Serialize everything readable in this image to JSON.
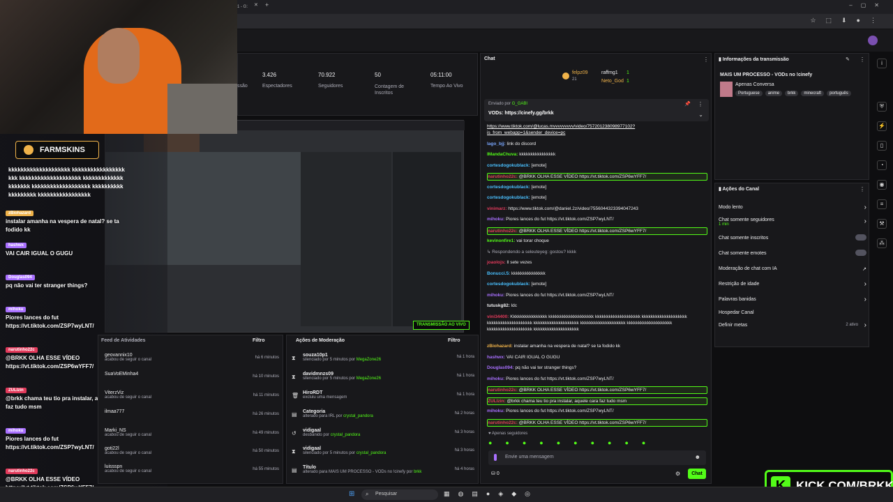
{
  "browser": {
    "tab_title": "1 - G:",
    "tab_plus": "+"
  },
  "stats": [
    {
      "value": "3.426",
      "label": "Espectadores"
    },
    {
      "value": "70.922",
      "label": "Seguidores"
    },
    {
      "value": "50",
      "label": "Contagem de Inscritos"
    },
    {
      "value": "05:11:00",
      "label": "Tempo Ao Vivo"
    }
  ],
  "stat_cut": "ssão",
  "overlay": {
    "sponsor": "FARMSKINS",
    "spam": "kkkkkkkkkkkkkkkkkkkk kkkkkkkkkkkkkkkkkkkk kkkkkkkkkkkkkkkkkkkk kkkkkkkkkkkkkkkkkkkk kkkkkkkkkkkkkkkkkkk kkkkkkkkkkkkkkkkkkk kkkkkkkkkkkkkkkkk",
    "messages": [
      {
        "user": "zBiohazard",
        "color": "#f0b34a",
        "text": "instalar amanha na vespera de natal? se ta fodido kk"
      },
      {
        "user": "hashwx",
        "color": "#a970ff",
        "text": "VAI CAIR IGUAL O GUGU"
      },
      {
        "user": "Douglas094",
        "color": "#a970ff",
        "text": "pq não vai ter stranger things?"
      },
      {
        "user": "mihoku",
        "color": "#a970ff",
        "text": "Piores lances do fut https://vt.tiktok.com/ZSP7wyLNT/"
      },
      {
        "user": "narutinho22c",
        "color": "#e23a5b",
        "text": "@BRKK OLHA ESSE VÍDEO https://vt.tiktok.com/ZSP6wYFF7/"
      },
      {
        "user": "ZULIzin",
        "color": "#e23a5b",
        "text": "@brkk chama teu tio pra instalar, aquele cara faz tudo msm"
      },
      {
        "user": "mihoku",
        "color": "#a970ff",
        "text": "Piores lances do fut https://vt.tiktok.com/ZSP7wyLNT/"
      },
      {
        "user": "narutinho22c",
        "color": "#e23a5b",
        "text": "@BRKK OLHA ESSE VÍDEO https://vt.tiktok.com/ZSP6wYFF7/"
      }
    ]
  },
  "preview": {
    "badge": "TRANSMISSÃO AO VIVO"
  },
  "feed": {
    "title": "Feed de Atividades",
    "filter": "Filtro",
    "items": [
      {
        "name": "geovannix10",
        "sub": "acabou de seguir o canal",
        "time": "há 6 minutos"
      },
      {
        "name": "SuaVoEMinha4",
        "sub": "",
        "time": "há 10 minutos"
      },
      {
        "name": "ViterzViz",
        "sub": "acabou de seguir o canal",
        "time": "há 11 minutos"
      },
      {
        "name": "ilmaa777",
        "sub": "",
        "time": "há 26 minutos"
      },
      {
        "name": "Marki_NS",
        "sub": "acabou de seguir o canal",
        "time": "há 49 minutos"
      },
      {
        "name": "goti22l",
        "sub": "acabou de seguir o canal",
        "time": "há 50 minutos"
      },
      {
        "name": "luissspn",
        "sub": "acabou de seguir o canal",
        "time": "há 55 minutos"
      }
    ]
  },
  "moderation": {
    "title": "Ações de Moderação",
    "filter": "Filtro",
    "items": [
      {
        "icon": "⧗",
        "name": "souza10p1",
        "sub": "silenciado por 5 minutos por",
        "by": "MegaZone26",
        "time": "há 1 hora"
      },
      {
        "icon": "⧗",
        "name": "davidmnzs09",
        "sub": "silenciado por 5 minutos por",
        "by": "MegaZone26",
        "time": "há 1 hora"
      },
      {
        "icon": "🗑",
        "name": "HiroRDT",
        "sub": "excluiu uma mensagem",
        "by": "",
        "time": "há 1 hora"
      },
      {
        "icon": "▤",
        "name": "Categoria",
        "sub": "alterado para IRL por",
        "by": "crystal_pandora",
        "time": "há 2 horas"
      },
      {
        "icon": "↺",
        "name": "vidigaal",
        "sub": "desbanido por",
        "by": "crystal_pandora",
        "time": "há 3 horas"
      },
      {
        "icon": "⧗",
        "name": "vidigaal",
        "sub": "silenciado por 5 minutos por",
        "by": "crystal_pandora",
        "time": "há 3 horas"
      },
      {
        "icon": "▤",
        "name": "Título",
        "sub": "alterado para MAIS UM PROCESSO - VODs no !cinefy por",
        "by": "brkk",
        "time": "há 4 horas"
      }
    ]
  },
  "chat": {
    "title": "Chat",
    "top_gifters": [
      {
        "name": "felpz09",
        "count": "21"
      },
      {
        "name": "raffmg1",
        "count": "1"
      },
      {
        "name": "Neto_God",
        "count": "1"
      }
    ],
    "pinned_label": "Enviado por",
    "pinned_by": "G_GABI",
    "pinned_text": "VODs: https://cinefy.gg/brkk",
    "lines": [
      {
        "user": "",
        "color": "#fff",
        "text": "https://www.tiktok.com/@lucas.mvvvvvvvvv/video/757201238098977102?is_from_webapp=1&sender_device=pc",
        "hl": false,
        "link": true
      },
      {
        "user": "lago_bjj:",
        "color": "#7aa7ff",
        "text": "link do discord",
        "hl": false
      },
      {
        "user": "IMandaChuva:",
        "color": "#53fc18",
        "text": "kkkkkkkkkkkkkkkk",
        "hl": false
      },
      {
        "user": "cortesdogokublack:",
        "color": "#4ac0ff",
        "text": "[emote]",
        "hl": false
      },
      {
        "user": "narutinho22c:",
        "color": "#e23a5b",
        "text": "@BRKK OLHA ESSE VÍDEO https://vt.tiktok.com/ZSP6wYFF7/",
        "hl": true
      },
      {
        "user": "cortesdogokublack:",
        "color": "#4ac0ff",
        "text": "[emote]",
        "hl": false
      },
      {
        "user": "cortesdogokublack:",
        "color": "#4ac0ff",
        "text": "[emote]",
        "hl": false
      },
      {
        "user": "vinimarz:",
        "color": "#e23a5b",
        "text": "https://www.tiktok.com/@daniel.2z/video/7556044323394047243",
        "hl": false
      },
      {
        "user": "mihoku:",
        "color": "#a970ff",
        "text": "Piores lances do fut https://vt.tiktok.com/ZSP7wyLNT/",
        "hl": false
      },
      {
        "user": "narutinho22c:",
        "color": "#e23a5b",
        "text": "@BRKK OLHA ESSE VÍDEO https://vt.tiktok.com/ZSP6wYFF7/",
        "hl": true
      },
      {
        "user": "kevinonfire1:",
        "color": "#53fc18",
        "text": "vai torar choque",
        "hl": false
      },
      {
        "user": "",
        "color": "#adadb8",
        "text": "↳ Respondendo a seleuteyeg: gostou? kkkk",
        "hl": false
      },
      {
        "user": "joaolojs:",
        "color": "#e23a5b",
        "text": "ll sete vezes",
        "hl": false
      },
      {
        "user": "Bonucci.5:",
        "color": "#4ac0ff",
        "text": "kkkkkkkkkkkkkkk",
        "hl": false
      },
      {
        "user": "cortesdogokublack:",
        "color": "#4ac0ff",
        "text": "[emote]",
        "hl": false
      },
      {
        "user": "mihoku:",
        "color": "#a970ff",
        "text": "Piores lances do fut https://vt.tiktok.com/ZSP7wyLNT/",
        "hl": false
      },
      {
        "user": "tutuskg82:",
        "color": "#efeff1",
        "text": "ldc",
        "hl": false
      },
      {
        "user": "vini34400:",
        "color": "#e23a5b",
        "text": "Kkkkkkkkkkkkkkkk kkkkkkkkkkkkkkkkkkkk kkkkkkkkkkkkkkkkkkkk kkkkkkkkkkkkkkkkkkkk kkkkkkkkkkkkkkkkkkkk kkkkkkkkkkkkkkkkkkkk kkkkkkkkkkkkkkkkkkkk kkkkkkkkkkkkkkkkkkkk kkkkkkkkkkkkkkkkkkkk kkkkkkkkkkkkkkkkkkkk",
        "hl": false
      },
      {
        "user": "zBiohazard:",
        "color": "#f0b34a",
        "text": "instalar amanha na vespera de natal? se ta fodido kk",
        "hl": false
      },
      {
        "user": "hashwx:",
        "color": "#a970ff",
        "text": "VAI CAIR IGUAL O GUGU",
        "hl": false
      },
      {
        "user": "Douglas094:",
        "color": "#a970ff",
        "text": "pq não vai ter stranger things?",
        "hl": false
      },
      {
        "user": "mihoku:",
        "color": "#a970ff",
        "text": "Piores lances do fut https://vt.tiktok.com/ZSP7wyLNT/",
        "hl": false
      },
      {
        "user": "narutinho22c:",
        "color": "#e23a5b",
        "text": "@BRKK OLHA ESSE VÍDEO https://vt.tiktok.com/ZSP6wYFF7/",
        "hl": true
      },
      {
        "user": "ZULIzin:",
        "color": "#e23a5b",
        "text": "@brkk chama teu tio pra instalar, aquele cara faz tudo msm",
        "hl": true
      },
      {
        "user": "mihoku:",
        "color": "#a970ff",
        "text": "Piores lances do fut https://vt.tiktok.com/ZSP7wyLNT/",
        "hl": false
      },
      {
        "user": "narutinho22c:",
        "color": "#e23a5b",
        "text": "@BRKK OLHA ESSE VÍDEO https://vt.tiktok.com/ZSP6wYFF7/",
        "hl": true
      }
    ],
    "followers_only": "Apenas seguidores",
    "input_placeholder": "Envie uma mensagem",
    "count": "0",
    "send_label": "Chat"
  },
  "stream_info": {
    "title": "Informações da transmissão",
    "stream_title": "MAIS UM PROCESSO - VODs no !cinefy",
    "category": "Apenas Conversa",
    "tags": [
      "Portuguese",
      "anime",
      "brkk",
      "minecraft",
      "português"
    ]
  },
  "channel_actions": {
    "title": "Ações do Canal",
    "items": [
      {
        "label": "Modo lento",
        "sub": "",
        "type": "arrow"
      },
      {
        "label": "Chat somente seguidores",
        "sub": "1 min",
        "type": "arrow"
      },
      {
        "label": "Chat somente inscritos",
        "sub": "",
        "type": "toggle"
      },
      {
        "label": "Chat somente emotes",
        "sub": "",
        "type": "toggle"
      },
      {
        "label": "Moderação de chat com IA",
        "sub": "",
        "type": "ext"
      },
      {
        "label": "Restrição de idade",
        "sub": "",
        "type": "arrow"
      },
      {
        "label": "Palavras banidas",
        "sub": "",
        "type": "arrow"
      },
      {
        "label": "Hospedar Canal",
        "sub": "",
        "type": "none"
      },
      {
        "label": "Definir metas",
        "sub": "2 ativo",
        "type": "arrow"
      }
    ]
  },
  "brand": {
    "text": "KICK.COM/BRKK",
    "accent": "#53fc18"
  },
  "taskbar": {
    "search": "Pesquisar"
  }
}
